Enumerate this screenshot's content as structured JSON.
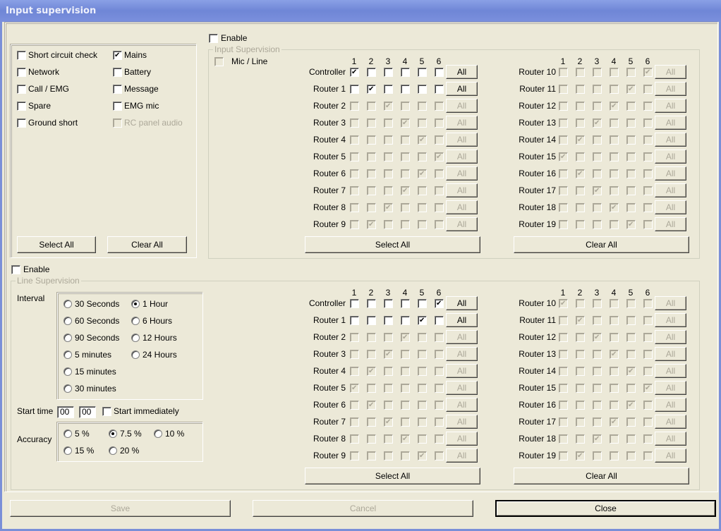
{
  "window": {
    "title": "Input supervision"
  },
  "alarms": {
    "items": [
      {
        "label": "Short circuit check",
        "checked": false,
        "disabled": false
      },
      {
        "label": "Network",
        "checked": false,
        "disabled": false
      },
      {
        "label": "Call / EMG",
        "checked": false,
        "disabled": false
      },
      {
        "label": "Spare",
        "checked": false,
        "disabled": false
      },
      {
        "label": "Ground short",
        "checked": false,
        "disabled": false
      },
      {
        "label": "Mains",
        "checked": true,
        "disabled": false
      },
      {
        "label": "Battery",
        "checked": false,
        "disabled": false
      },
      {
        "label": "Message",
        "checked": false,
        "disabled": false
      },
      {
        "label": "EMG mic",
        "checked": false,
        "disabled": false
      },
      {
        "label": "RC panel audio",
        "checked": false,
        "disabled": true
      }
    ],
    "select_all": "Select All",
    "clear_all": "Clear All"
  },
  "input_supervision": {
    "enable_label": "Enable",
    "enable_checked": false,
    "group_title": "Input Supervision",
    "mic_line_label": "Mic / Line",
    "mic_line_checked": false,
    "columns": [
      "1",
      "2",
      "3",
      "4",
      "5",
      "6"
    ],
    "all_label": "All",
    "left_rows": [
      {
        "label": "Controller",
        "checked": 1,
        "enabled": true
      },
      {
        "label": "Router 1",
        "checked": 2,
        "enabled": true
      },
      {
        "label": "Router 2",
        "checked": 3,
        "enabled": false
      },
      {
        "label": "Router 3",
        "checked": 4,
        "enabled": false
      },
      {
        "label": "Router 4",
        "checked": 5,
        "enabled": false
      },
      {
        "label": "Router 5",
        "checked": 6,
        "enabled": false
      },
      {
        "label": "Router 6",
        "checked": 5,
        "enabled": false
      },
      {
        "label": "Router 7",
        "checked": 4,
        "enabled": false
      },
      {
        "label": "Router 8",
        "checked": 3,
        "enabled": false
      },
      {
        "label": "Router 9",
        "checked": 2,
        "enabled": false
      }
    ],
    "right_rows": [
      {
        "label": "Router 10",
        "checked": 6,
        "enabled": false
      },
      {
        "label": "Router 11",
        "checked": 5,
        "enabled": false
      },
      {
        "label": "Router 12",
        "checked": 4,
        "enabled": false
      },
      {
        "label": "Router 13",
        "checked": 3,
        "enabled": false
      },
      {
        "label": "Router 14",
        "checked": 2,
        "enabled": false
      },
      {
        "label": "Router 15",
        "checked": 1,
        "enabled": false
      },
      {
        "label": "Router 16",
        "checked": 2,
        "enabled": false
      },
      {
        "label": "Router 17",
        "checked": 3,
        "enabled": false
      },
      {
        "label": "Router 18",
        "checked": 4,
        "enabled": false
      },
      {
        "label": "Router 19",
        "checked": 5,
        "enabled": false
      }
    ],
    "select_all": "Select All",
    "clear_all": "Clear All"
  },
  "line_supervision": {
    "enable_label": "Enable",
    "enable_checked": false,
    "group_title": "Line Supervision",
    "interval_label": "Interval",
    "interval_options": [
      {
        "label": "30 Seconds",
        "selected": false
      },
      {
        "label": "60 Seconds",
        "selected": false
      },
      {
        "label": "90 Seconds",
        "selected": false
      },
      {
        "label": "5 minutes",
        "selected": false
      },
      {
        "label": "15 minutes",
        "selected": false
      },
      {
        "label": "30 minutes",
        "selected": false
      },
      {
        "label": "1 Hour",
        "selected": true
      },
      {
        "label": "6 Hours",
        "selected": false
      },
      {
        "label": "12 Hours",
        "selected": false
      },
      {
        "label": "24 Hours",
        "selected": false
      }
    ],
    "start_time_label": "Start time",
    "start_hour": "00",
    "start_minute": "00",
    "start_immediately_label": "Start immediately",
    "start_immediately_checked": false,
    "accuracy_label": "Accuracy",
    "accuracy_options": [
      {
        "label": "5 %",
        "selected": false
      },
      {
        "label": "7.5 %",
        "selected": true
      },
      {
        "label": "10 %",
        "selected": false
      },
      {
        "label": "15 %",
        "selected": false
      },
      {
        "label": "20 %",
        "selected": false
      }
    ],
    "columns": [
      "1",
      "2",
      "3",
      "4",
      "5",
      "6"
    ],
    "all_label": "All",
    "left_rows": [
      {
        "label": "Controller",
        "checked": 6,
        "enabled": true
      },
      {
        "label": "Router 1",
        "checked": 5,
        "enabled": true
      },
      {
        "label": "Router 2",
        "checked": 4,
        "enabled": false
      },
      {
        "label": "Router 3",
        "checked": 3,
        "enabled": false
      },
      {
        "label": "Router 4",
        "checked": 2,
        "enabled": false
      },
      {
        "label": "Router 5",
        "checked": 1,
        "enabled": false
      },
      {
        "label": "Router 6",
        "checked": 2,
        "enabled": false
      },
      {
        "label": "Router 7",
        "checked": 3,
        "enabled": false
      },
      {
        "label": "Router 8",
        "checked": 4,
        "enabled": false
      },
      {
        "label": "Router 9",
        "checked": 5,
        "enabled": false
      }
    ],
    "right_rows": [
      {
        "label": "Router 10",
        "checked": 1,
        "enabled": false
      },
      {
        "label": "Router 11",
        "checked": 2,
        "enabled": false
      },
      {
        "label": "Router 12",
        "checked": 3,
        "enabled": false
      },
      {
        "label": "Router 13",
        "checked": 4,
        "enabled": false
      },
      {
        "label": "Router 14",
        "checked": 5,
        "enabled": false
      },
      {
        "label": "Router 15",
        "checked": 6,
        "enabled": false
      },
      {
        "label": "Router 16",
        "checked": 5,
        "enabled": false
      },
      {
        "label": "Router 17",
        "checked": 4,
        "enabled": false
      },
      {
        "label": "Router 18",
        "checked": 3,
        "enabled": false
      },
      {
        "label": "Router 19",
        "checked": 2,
        "enabled": false
      }
    ],
    "select_all": "Select All",
    "clear_all": "Clear All"
  },
  "footer": {
    "save": "Save",
    "save_enabled": false,
    "cancel": "Cancel",
    "cancel_enabled": false,
    "close": "Close"
  }
}
